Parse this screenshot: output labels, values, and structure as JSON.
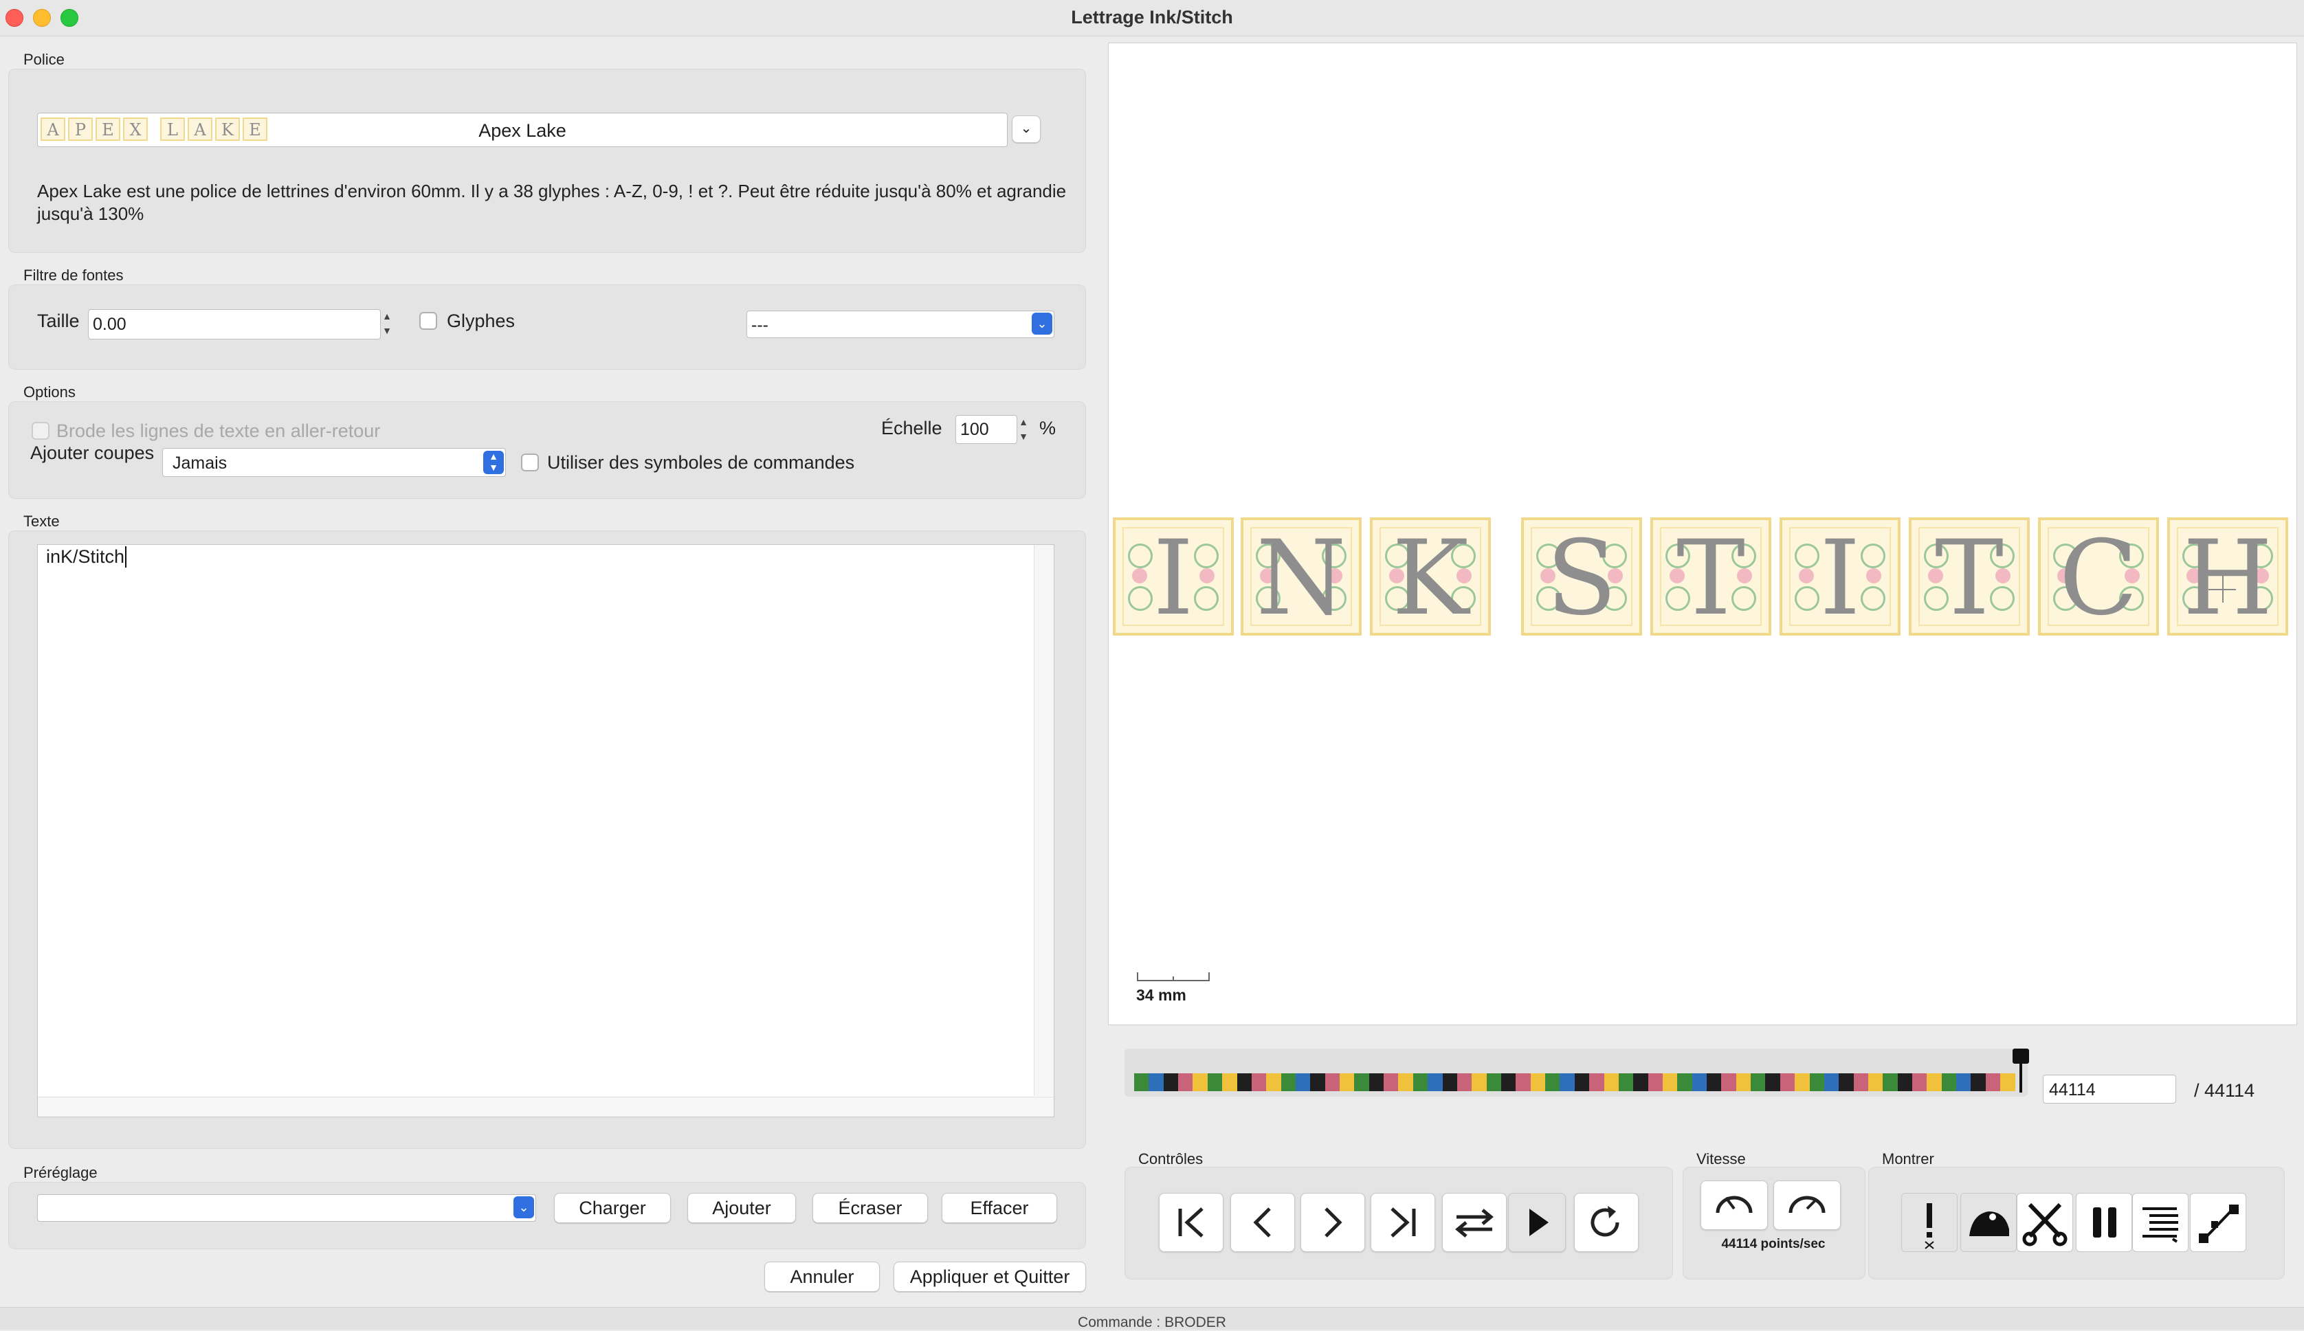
{
  "window": {
    "title": "Lettrage Ink/Stitch"
  },
  "font_section": {
    "label": "Police",
    "selected_font": "Apex Lake",
    "preview_letters": [
      "A",
      "P",
      "E",
      "X",
      "L",
      "A",
      "K",
      "E"
    ],
    "description": "Apex Lake est une police de lettrines d'environ 60mm. Il y a 38 glyphes : A-Z, 0-9, ! et ?. Peut être réduite jusqu'à 80% et agrandie jusqu'à 130%"
  },
  "filter_section": {
    "label": "Filtre de fontes",
    "size_label": "Taille",
    "size_value": "0.00",
    "glyphs_label": "Glyphes",
    "glyphs_checked": false,
    "dropdown_value": "---"
  },
  "options_section": {
    "label": "Options",
    "back_forth_label": "Brode les lignes de texte en aller-retour",
    "back_forth_enabled": false,
    "scale_label": "Échelle",
    "scale_value": "100",
    "scale_unit": "%",
    "trims_label": "Ajouter coupes",
    "trims_value": "Jamais",
    "command_symbols_label": "Utiliser des symboles de commandes"
  },
  "text_section": {
    "label": "Texte",
    "value": "inK/Stitch"
  },
  "preset_section": {
    "label": "Préréglage",
    "value": "",
    "load": "Charger",
    "add": "Ajouter",
    "overwrite": "Écraser",
    "delete": "Effacer"
  },
  "dialog_buttons": {
    "cancel": "Annuler",
    "apply_quit": "Appliquer et Quitter"
  },
  "preview": {
    "letters": [
      "I",
      "N",
      "K",
      "S",
      "T",
      "I",
      "T",
      "C",
      "H"
    ],
    "scale_label": "34 mm",
    "colors": {
      "tile_bg": "#fdf6dc",
      "tile_border": "#f2d98a",
      "letter": "#8e8e8e",
      "leaf": "#9cc79a",
      "flower": "#f2b9c3"
    }
  },
  "timeline": {
    "current": "44114",
    "total": "/ 44114",
    "palette": [
      "#3b8a3a",
      "#1f1f1f",
      "#c9637a",
      "#f0c23c",
      "#2d6fb8"
    ]
  },
  "controls": {
    "label": "Contrôles",
    "buttons": [
      "jump-start",
      "step-back",
      "step-forward",
      "jump-end",
      "swap-direction",
      "play",
      "restart"
    ]
  },
  "speed": {
    "label": "Vitesse",
    "readout": "44114 points/sec"
  },
  "show": {
    "label": "Montrer",
    "buttons": [
      "error-marker",
      "jump-stitches",
      "trims",
      "stops",
      "color-changes",
      "needle-points"
    ]
  },
  "status_bar": {
    "text": "Commande : BRODER"
  }
}
